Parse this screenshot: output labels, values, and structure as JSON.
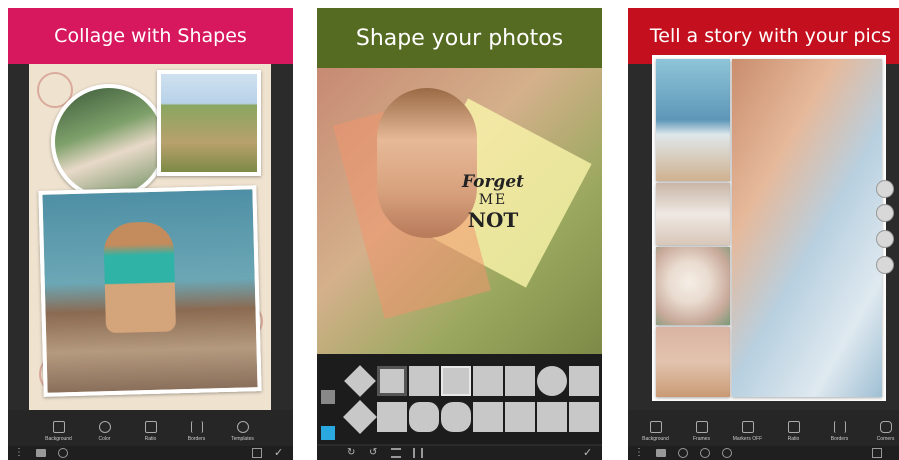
{
  "panels": [
    {
      "title": "Collage with Shapes",
      "banner_color": "#d7185e",
      "tools": [
        "Background",
        "Color",
        "Ratio",
        "Borders",
        "Templates"
      ]
    },
    {
      "title": "Shape your photos",
      "banner_color": "#566b22",
      "overlay_text": [
        "Forget",
        "ME",
        "NOT"
      ]
    },
    {
      "title": "Tell a story with your pics",
      "banner_color": "#c4101e",
      "tools": [
        "Background",
        "Frames",
        "Markers OFF",
        "Ratio",
        "Borders",
        "Corners"
      ]
    }
  ],
  "icons": {
    "menu": "menu-dots-icon",
    "folder": "folder-icon",
    "layers": "layers-icon",
    "save": "save-icon",
    "check": "check-icon",
    "undo": "undo-icon",
    "redo": "redo-icon",
    "zoom_in": "zoom-in-icon",
    "zoom_out": "zoom-out-icon",
    "shuffle": "shuffle-icon",
    "share": "share-icon",
    "swap": "swap-icon",
    "rotate": "rotate-icon"
  }
}
